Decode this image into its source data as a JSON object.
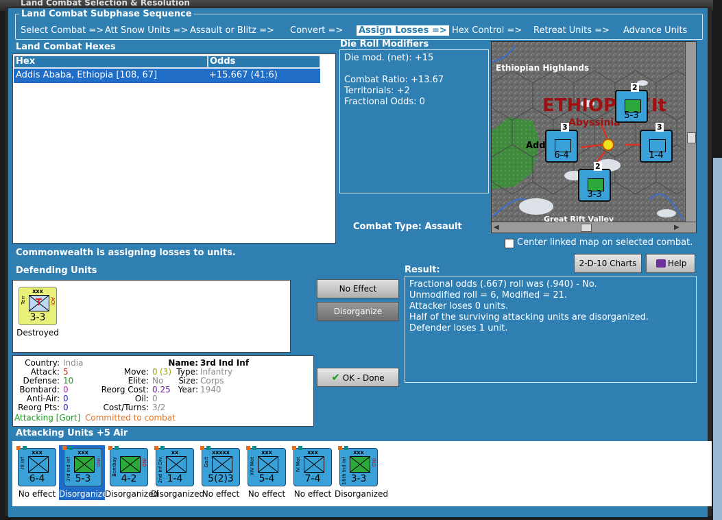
{
  "window": {
    "title": "Land Combat Selection & Resolution"
  },
  "subphase": {
    "title": "Land Combat Subphase Sequence",
    "steps": [
      {
        "label": "Select Combat =>"
      },
      {
        "label": "Att Snow Units =>"
      },
      {
        "label": "Assault or Blitz =>"
      },
      {
        "label": "Convert =>"
      },
      {
        "label": "Assign Losses =>"
      },
      {
        "label": "Hex Control =>"
      },
      {
        "label": "Retreat Units =>"
      },
      {
        "label": "Advance Units"
      }
    ],
    "active_step": "Assign Losses =>"
  },
  "hexes": {
    "title": "Land Combat Hexes",
    "col_hex": "Hex",
    "col_odds": "Odds",
    "rows": [
      {
        "hex": "Addis Ababa, Ethiopia [108, 67]",
        "odds": "+15.667 (41:6)"
      }
    ]
  },
  "die_roll": {
    "title": "Die Roll Modifiers",
    "net": "Die mod. (net): +15",
    "ratio": "Combat Ratio: +13.67",
    "territorials": "Territorials: +2",
    "fractional": "Fractional Odds: 0"
  },
  "combat_type": "Combat Type:  Assault",
  "map": {
    "labels": {
      "highlands": "Ethiopian Highlands",
      "country": "ETHIOPIA (It",
      "region": "Abyssinia",
      "city": "Add",
      "valley": "Great Rift Valley"
    },
    "counters": [
      {
        "num": "5-3",
        "stack": "2"
      },
      {
        "num": "6-4",
        "stack": "3"
      },
      {
        "num": "1-4",
        "stack": "3"
      },
      {
        "num": "3-3",
        "stack": "2"
      }
    ]
  },
  "center_checkbox": {
    "label": "Center linked map on selected combat.",
    "checked": false
  },
  "status_message": "Commonwealth is assigning losses to units.",
  "defending": {
    "title": "Defending Units",
    "units": [
      {
        "size": "xxx",
        "side": "Terr",
        "side_right": "AOI",
        "value": "3-3",
        "status": "Destroyed",
        "symbol": "T"
      }
    ]
  },
  "buttons": {
    "no_effect": "No Effect",
    "disorganize": "Disorganize",
    "ok_done": "OK - Done",
    "charts": "2-D-10 Charts",
    "help": "Help"
  },
  "result": {
    "title": "Result:",
    "lines": [
      "Fractional odds (.667) roll was (.940)  - No.",
      "Unmodified roll = 6, Modified = 21.",
      "Attacker loses 0 units.",
      "Half of the surviving attacking units are disorganized.",
      "Defender loses 1 unit."
    ]
  },
  "info": {
    "country_label": "Country:",
    "country": "India",
    "attack_label": "Attack:",
    "attack": "5",
    "defense_label": "Defense:",
    "defense": "10",
    "bombard_label": "Bombard:",
    "bombard": "0",
    "antiair_label": "Anti-Air:",
    "antiair": "0",
    "reorg_label": "Reorg Pts:",
    "reorg": "0",
    "move_label": "Move:",
    "move": "0",
    "move_extra": "(3)",
    "elite_label": "Elite:",
    "elite": "No",
    "reorgcost_label": "Reorg Cost:",
    "reorgcost": "0.25",
    "oil_label": "Oil:",
    "oil": "0",
    "costturns_label": "Cost/Turns:",
    "costturns": "3/2",
    "name_label": "Name:",
    "name": "3rd Ind Inf",
    "type_label": "Type:",
    "type": "Infantry",
    "size_label": "Size:",
    "size": "Corps",
    "year_label": "Year:",
    "year": "1940",
    "attacking_text": "Attacking [Gort]",
    "committed_text": "Committed to combat"
  },
  "attacking": {
    "title": "Attacking Units +5 Air",
    "units": [
      {
        "size": "xxx",
        "side": "III Inf",
        "side_right": "",
        "value": "6-4",
        "status": "No effect",
        "green": false
      },
      {
        "size": "xxx",
        "side": "3rd Ind Inf",
        "side_right": "IND",
        "value": "5-3",
        "status": "Disorganized",
        "green": true
      },
      {
        "size": "",
        "side": "Bombay",
        "side_right": "IND",
        "value": "4-2",
        "status": "Disorganized",
        "green": true
      },
      {
        "size": "xx",
        "side": "2nd Inf Div",
        "side_right": "",
        "value": "1-4",
        "status": "Disorganized",
        "green": false
      },
      {
        "size": "xxxxx",
        "side": "Gort",
        "side_right": "",
        "value": "5(2)3",
        "status": "No effect",
        "green": false
      },
      {
        "size": "xxx",
        "side": "XIV Mot",
        "side_right": "",
        "value": "5-4",
        "status": "No effect",
        "green": false
      },
      {
        "size": "xxx",
        "side": "IV Mot",
        "side_right": "",
        "value": "7-4",
        "status": "No effect",
        "green": false
      },
      {
        "size": "xxx",
        "side": "16th Ind Inf",
        "side_right": "IND",
        "value": "3-3",
        "status": "Disorganized",
        "green": true
      }
    ]
  },
  "colors": {
    "panel": "#2f7fb3",
    "selected_row": "#1f6dc7",
    "counter_blue": "#3aa0d8",
    "counter_green": "#2da83a",
    "counter_yellow": "#e8f07a"
  }
}
